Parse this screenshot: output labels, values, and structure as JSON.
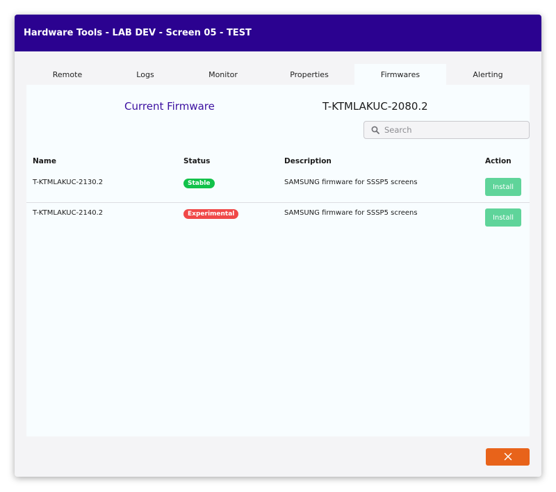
{
  "window": {
    "title": "Hardware Tools - LAB DEV - Screen 05 - TEST"
  },
  "tabs": [
    {
      "label": "Remote",
      "active": false
    },
    {
      "label": "Logs",
      "active": false
    },
    {
      "label": "Monitor",
      "active": false
    },
    {
      "label": "Properties",
      "active": false
    },
    {
      "label": "Firmwares",
      "active": true
    },
    {
      "label": "Alerting",
      "active": false
    }
  ],
  "current_firmware": {
    "label": "Current Firmware",
    "value": "T-KTMLAKUC-2080.2"
  },
  "search": {
    "placeholder": "Search",
    "value": "",
    "icon": "search-icon"
  },
  "table": {
    "headers": {
      "name": "Name",
      "status": "Status",
      "description": "Description",
      "action": "Action"
    },
    "rows": [
      {
        "name": "T-KTMLAKUC-2130.2",
        "status": "Stable",
        "status_color": "#12c24a",
        "description": "SAMSUNG firmware for SSSP5 screens",
        "action": "Install"
      },
      {
        "name": "T-KTMLAKUC-2140.2",
        "status": "Experimental",
        "status_color": "#f04848",
        "description": "SAMSUNG firmware for SSSP5 screens",
        "action": "Install"
      }
    ]
  },
  "close_button": {
    "icon": "close-icon"
  },
  "colors": {
    "header_bg": "#2b0290",
    "accent_purple": "#3b0fa0",
    "install_button": "#5fd49a",
    "close_button": "#e8631a"
  }
}
